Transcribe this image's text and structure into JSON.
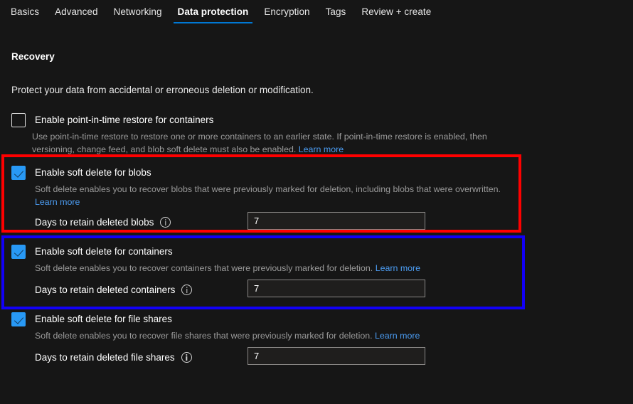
{
  "tabs": [
    {
      "label": "Basics",
      "active": false
    },
    {
      "label": "Advanced",
      "active": false
    },
    {
      "label": "Networking",
      "active": false
    },
    {
      "label": "Data protection",
      "active": true
    },
    {
      "label": "Encryption",
      "active": false
    },
    {
      "label": "Tags",
      "active": false
    },
    {
      "label": "Review + create",
      "active": false
    }
  ],
  "section": {
    "title": "Recovery",
    "description": "Protect your data from accidental or erroneous deletion or modification."
  },
  "options": {
    "point_in_time": {
      "label": "Enable point-in-time restore for containers",
      "checked": false,
      "helper": "Use point-in-time restore to restore one or more containers to an earlier state. If point-in-time restore is enabled, then versioning, change feed, and blob soft delete must also be enabled.",
      "link": "Learn more"
    },
    "soft_delete_blobs": {
      "label": "Enable soft delete for blobs",
      "checked": true,
      "helper": "Soft delete enables you to recover blobs that were previously marked for deletion, including blobs that were overwritten.",
      "link": "Learn more",
      "field_label": "Days to retain deleted blobs",
      "field_value": "7",
      "info_icon": "info-icon"
    },
    "soft_delete_containers": {
      "label": "Enable soft delete for containers",
      "checked": true,
      "helper": "Soft delete enables you to recover containers that were previously marked for deletion.",
      "link": "Learn more",
      "field_label": "Days to retain deleted containers",
      "field_value": "7",
      "info_icon": "info-icon"
    },
    "soft_delete_file_shares": {
      "label": "Enable soft delete for file shares",
      "checked": true,
      "helper": "Soft delete enables you to recover file shares that were previously marked for deletion.",
      "link": "Learn more",
      "field_label": "Days to retain deleted file shares",
      "field_value": "7",
      "info_icon": "info-icon"
    }
  },
  "annotations": {
    "red_box": {
      "color": "#fe0000",
      "target": "soft_delete_blobs"
    },
    "blue_box": {
      "color": "#1200f7",
      "target": "soft_delete_containers"
    }
  },
  "colors": {
    "background": "#161616",
    "accent": "#0078d4",
    "checkbox": "#2899f5",
    "link": "#4c9ef5",
    "helper_text": "#9a9a9a"
  }
}
